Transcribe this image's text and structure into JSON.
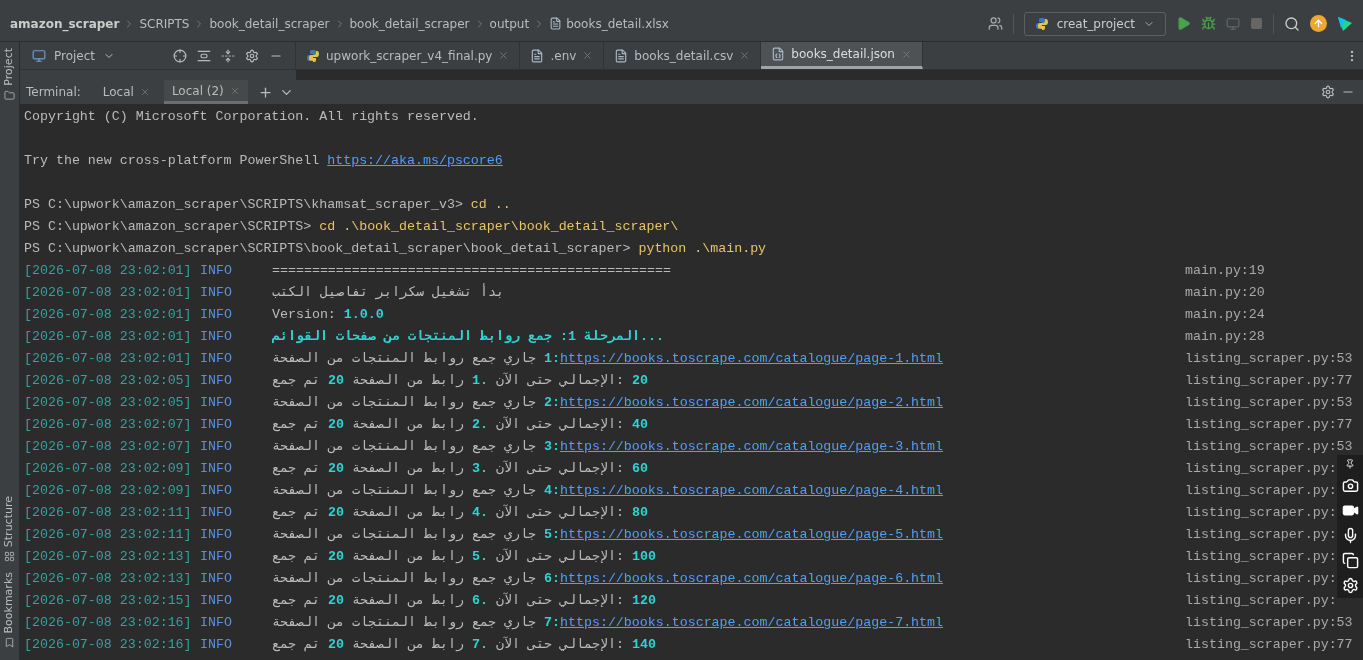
{
  "breadcrumbs": [
    {
      "label": "amazon_scraper",
      "kind": "root"
    },
    {
      "label": "SCRIPTS",
      "kind": "folder"
    },
    {
      "label": "book_detail_scraper",
      "kind": "folder"
    },
    {
      "label": "book_detail_scraper",
      "kind": "folder"
    },
    {
      "label": "output",
      "kind": "folder"
    },
    {
      "label": "books_detail.xlsx",
      "kind": "file"
    }
  ],
  "run_config": "creat_project",
  "side_tabs": [
    {
      "label": "Project",
      "kind": "project"
    },
    {
      "label": "Structure",
      "kind": "structure"
    },
    {
      "label": "Bookmarks",
      "kind": "bookmarks"
    }
  ],
  "project_panel": {
    "title": "Project"
  },
  "editor_tabs": [
    {
      "label": "upwork_scraper_v4_final.py",
      "kind": "python",
      "selected": false
    },
    {
      "label": ".env",
      "kind": "text",
      "selected": false
    },
    {
      "label": "books_detail.csv",
      "kind": "text",
      "selected": false
    },
    {
      "label": "books_detail.json",
      "kind": "json",
      "selected": true
    }
  ],
  "terminal": {
    "label": "Terminal:",
    "tabs": [
      {
        "label": "Local",
        "selected": false
      },
      {
        "label": "Local (2)",
        "selected": true
      }
    ]
  },
  "console_lines": [
    {
      "kind": "text",
      "segments": [
        {
          "kind": "text",
          "text": "Copyright (C) Microsoft Corporation. All rights reserved."
        }
      ]
    },
    {
      "kind": "gap"
    },
    {
      "kind": "text",
      "segments": [
        {
          "kind": "text",
          "text": "Try the new cross-platform PowerShell "
        },
        {
          "kind": "link",
          "text": "https://aka.ms/pscore6"
        }
      ]
    },
    {
      "kind": "gap"
    },
    {
      "kind": "text",
      "segments": [
        {
          "kind": "text",
          "text": "PS C:\\upwork\\amazon_scraper\\SCRIPTS\\khamsat_scraper_v3> "
        },
        {
          "kind": "command",
          "text": "cd .."
        }
      ]
    },
    {
      "kind": "text",
      "segments": [
        {
          "kind": "text",
          "text": "PS C:\\upwork\\amazon_scraper\\SCRIPTS> "
        },
        {
          "kind": "command",
          "text": "cd .\\book_detail_scraper\\book_detail_scraper\\"
        }
      ]
    },
    {
      "kind": "text",
      "segments": [
        {
          "kind": "text",
          "text": "PS C:\\upwork\\amazon_scraper\\SCRIPTS\\book_detail_scraper\\book_detail_scraper> "
        },
        {
          "kind": "command",
          "text": "python .\\main.py"
        }
      ]
    }
  ],
  "log_lines": [
    {
      "timestamp": "[2026-07-08 23:02:01]",
      "level": "INFO",
      "segments": [
        {
          "kind": "text",
          "text": "=================================================="
        }
      ],
      "source": "main.py:19"
    },
    {
      "timestamp": "[2026-07-08 23:02:01]",
      "level": "INFO",
      "segments": [
        {
          "kind": "text",
          "text": "بدأ تشغيل سكرابر تفاصيل الكتب"
        }
      ],
      "source": "main.py:20"
    },
    {
      "timestamp": "[2026-07-08 23:02:01]",
      "level": "INFO",
      "segments": [
        {
          "kind": "text",
          "text": "Version: "
        },
        {
          "kind": "number",
          "text": "1.0.0"
        }
      ],
      "source": "main.py:24"
    },
    {
      "timestamp": "[2026-07-08 23:02:01]",
      "level": "INFO",
      "segments": [
        {
          "kind": "phase",
          "text": "المرحلة 1: جمع روابط المنتجات من صفحات القوائم..."
        }
      ],
      "source": "main.py:28"
    },
    {
      "timestamp": "[2026-07-08 23:02:01]",
      "level": "INFO",
      "segments": [
        {
          "kind": "text",
          "text": "جاري جمع روابط المنتجات من الصفحة "
        },
        {
          "kind": "number",
          "text": "1:"
        },
        {
          "kind": "link",
          "text": "https://books.toscrape.com/catalogue/page-1.html"
        }
      ],
      "source": "listing_scraper.py:53"
    },
    {
      "timestamp": "[2026-07-08 23:02:05]",
      "level": "INFO",
      "segments": [
        {
          "kind": "text",
          "text": "تم جمع "
        },
        {
          "kind": "number",
          "text": "20"
        },
        {
          "kind": "text",
          "text": " رابط من الصفحة "
        },
        {
          "kind": "number",
          "text": "1."
        },
        {
          "kind": "text",
          "text": " الإجمالي حتى الآن: "
        },
        {
          "kind": "number",
          "text": "20"
        }
      ],
      "source": "listing_scraper.py:77"
    },
    {
      "timestamp": "[2026-07-08 23:02:05]",
      "level": "INFO",
      "segments": [
        {
          "kind": "text",
          "text": "جاري جمع روابط المنتجات من الصفحة "
        },
        {
          "kind": "number",
          "text": "2:"
        },
        {
          "kind": "link",
          "text": "https://books.toscrape.com/catalogue/page-2.html"
        }
      ],
      "source": "listing_scraper.py:53"
    },
    {
      "timestamp": "[2026-07-08 23:02:07]",
      "level": "INFO",
      "segments": [
        {
          "kind": "text",
          "text": "تم جمع "
        },
        {
          "kind": "number",
          "text": "20"
        },
        {
          "kind": "text",
          "text": " رابط من الصفحة "
        },
        {
          "kind": "number",
          "text": "2."
        },
        {
          "kind": "text",
          "text": " الإجمالي حتى الآن: "
        },
        {
          "kind": "number",
          "text": "40"
        }
      ],
      "source": "listing_scraper.py:77"
    },
    {
      "timestamp": "[2026-07-08 23:02:07]",
      "level": "INFO",
      "segments": [
        {
          "kind": "text",
          "text": "جاري جمع روابط المنتجات من الصفحة "
        },
        {
          "kind": "number",
          "text": "3:"
        },
        {
          "kind": "link",
          "text": "https://books.toscrape.com/catalogue/page-3.html"
        }
      ],
      "source": "listing_scraper.py:53"
    },
    {
      "timestamp": "[2026-07-08 23:02:09]",
      "level": "INFO",
      "segments": [
        {
          "kind": "text",
          "text": "تم جمع "
        },
        {
          "kind": "number",
          "text": "20"
        },
        {
          "kind": "text",
          "text": " رابط من الصفحة "
        },
        {
          "kind": "number",
          "text": "3."
        },
        {
          "kind": "text",
          "text": " الإجمالي حتى الآن: "
        },
        {
          "kind": "number",
          "text": "60"
        }
      ],
      "source": "listing_scraper.py:"
    },
    {
      "timestamp": "[2026-07-08 23:02:09]",
      "level": "INFO",
      "segments": [
        {
          "kind": "text",
          "text": "جاري جمع روابط المنتجات من الصفحة "
        },
        {
          "kind": "number",
          "text": "4:"
        },
        {
          "kind": "link",
          "text": "https://books.toscrape.com/catalogue/page-4.html"
        }
      ],
      "source": "listing_scraper.py:"
    },
    {
      "timestamp": "[2026-07-08 23:02:11]",
      "level": "INFO",
      "segments": [
        {
          "kind": "text",
          "text": "تم جمع "
        },
        {
          "kind": "number",
          "text": "20"
        },
        {
          "kind": "text",
          "text": " رابط من الصفحة "
        },
        {
          "kind": "number",
          "text": "4."
        },
        {
          "kind": "text",
          "text": " الإجمالي حتى الآن: "
        },
        {
          "kind": "number",
          "text": "80"
        }
      ],
      "source": "listing_scraper.py:"
    },
    {
      "timestamp": "[2026-07-08 23:02:11]",
      "level": "INFO",
      "segments": [
        {
          "kind": "text",
          "text": "جاري جمع روابط المنتجات من الصفحة "
        },
        {
          "kind": "number",
          "text": "5:"
        },
        {
          "kind": "link",
          "text": "https://books.toscrape.com/catalogue/page-5.html"
        }
      ],
      "source": "listing_scraper.py:"
    },
    {
      "timestamp": "[2026-07-08 23:02:13]",
      "level": "INFO",
      "segments": [
        {
          "kind": "text",
          "text": "تم جمع "
        },
        {
          "kind": "number",
          "text": "20"
        },
        {
          "kind": "text",
          "text": " رابط من الصفحة "
        },
        {
          "kind": "number",
          "text": "5."
        },
        {
          "kind": "text",
          "text": " الإجمالي حتى الآن: "
        },
        {
          "kind": "number",
          "text": "100"
        }
      ],
      "source": "listing_scraper.py:"
    },
    {
      "timestamp": "[2026-07-08 23:02:13]",
      "level": "INFO",
      "segments": [
        {
          "kind": "text",
          "text": "جاري جمع روابط المنتجات من الصفحة "
        },
        {
          "kind": "number",
          "text": "6:"
        },
        {
          "kind": "link",
          "text": "https://books.toscrape.com/catalogue/page-6.html"
        }
      ],
      "source": "listing_scraper.py:"
    },
    {
      "timestamp": "[2026-07-08 23:02:15]",
      "level": "INFO",
      "segments": [
        {
          "kind": "text",
          "text": "تم جمع "
        },
        {
          "kind": "number",
          "text": "20"
        },
        {
          "kind": "text",
          "text": " رابط من الصفحة "
        },
        {
          "kind": "number",
          "text": "6."
        },
        {
          "kind": "text",
          "text": " الإجمالي حتى الآن: "
        },
        {
          "kind": "number",
          "text": "120"
        }
      ],
      "source": "listing_scraper.py:"
    },
    {
      "timestamp": "[2026-07-08 23:02:16]",
      "level": "INFO",
      "segments": [
        {
          "kind": "text",
          "text": "جاري جمع روابط المنتجات من الصفحة "
        },
        {
          "kind": "number",
          "text": "7:"
        },
        {
          "kind": "link",
          "text": "https://books.toscrape.com/catalogue/page-7.html"
        }
      ],
      "source": "listing_scraper.py:53"
    },
    {
      "timestamp": "[2026-07-08 23:02:16]",
      "level": "INFO",
      "segments": [
        {
          "kind": "text",
          "text": "تم جمع "
        },
        {
          "kind": "number",
          "text": "20"
        },
        {
          "kind": "text",
          "text": " رابط من الصفحة "
        },
        {
          "kind": "number",
          "text": "7."
        },
        {
          "kind": "text",
          "text": " الإجمالي حتى الآن: "
        },
        {
          "kind": "number",
          "text": "140"
        }
      ],
      "source": "listing_scraper.py:77"
    }
  ]
}
